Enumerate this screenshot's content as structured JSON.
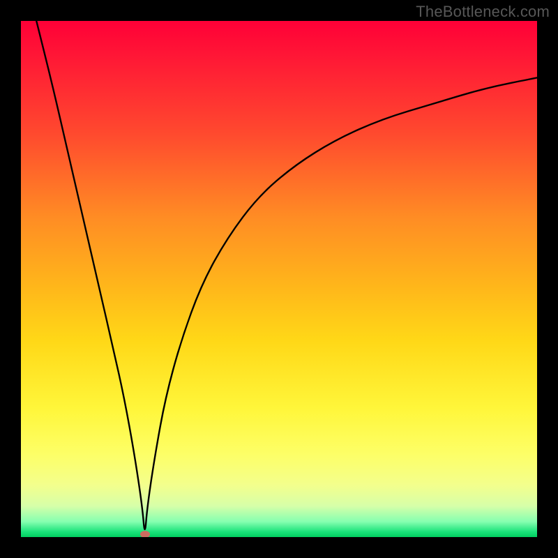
{
  "watermark": "TheBottleneck.com",
  "chart_data": {
    "type": "line",
    "title": "",
    "xlabel": "",
    "ylabel": "",
    "x_range": [
      0,
      100
    ],
    "y_range": [
      0,
      100
    ],
    "notes": "Bottleneck-style V-curve over vertical heatmap gradient (red high → green low). Minimum (0% bottleneck) near x≈24.",
    "gradient_stops": [
      {
        "pos": 0.0,
        "color": "#ff0037"
      },
      {
        "pos": 0.06,
        "color": "#ff1436"
      },
      {
        "pos": 0.22,
        "color": "#ff4a2e"
      },
      {
        "pos": 0.38,
        "color": "#ff8c24"
      },
      {
        "pos": 0.52,
        "color": "#ffb81a"
      },
      {
        "pos": 0.62,
        "color": "#ffd817"
      },
      {
        "pos": 0.75,
        "color": "#fff63a"
      },
      {
        "pos": 0.84,
        "color": "#fdff67"
      },
      {
        "pos": 0.9,
        "color": "#f3ff8d"
      },
      {
        "pos": 0.94,
        "color": "#d6ffa9"
      },
      {
        "pos": 0.97,
        "color": "#86ffb0"
      },
      {
        "pos": 0.99,
        "color": "#19e37a"
      },
      {
        "pos": 1.0,
        "color": "#01ce60"
      }
    ],
    "series": [
      {
        "name": "bottleneck-curve",
        "x": [
          3,
          6,
          9,
          12,
          15,
          18,
          20,
          22,
          23.5,
          24,
          24.5,
          26,
          28,
          31,
          35,
          40,
          46,
          53,
          61,
          70,
          80,
          90,
          100
        ],
        "y": [
          100,
          88,
          75,
          62,
          49,
          36,
          27,
          16,
          6,
          0,
          6,
          16,
          27,
          38,
          49,
          58,
          66,
          72,
          77,
          81,
          84,
          87,
          89
        ]
      }
    ],
    "marker": {
      "x": 24,
      "y": 0,
      "color": "#cc6c60"
    }
  }
}
